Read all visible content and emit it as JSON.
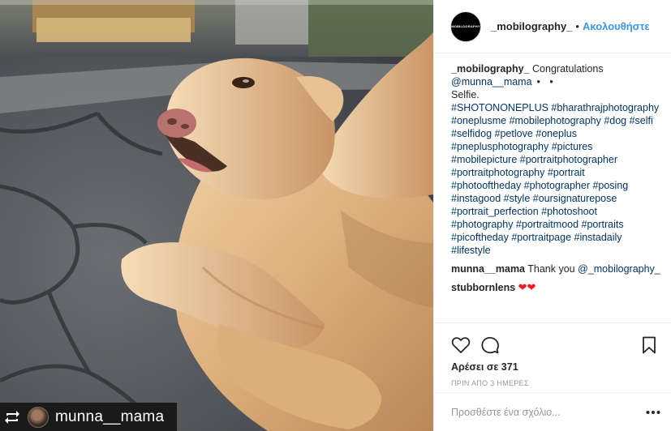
{
  "post": {
    "repost_username": "munna__mama"
  },
  "header": {
    "avatar_text": "MOBILOGRAPHY",
    "username": "_mobilography_",
    "separator": "•",
    "follow_label": "Ακολουθήστε"
  },
  "caption": {
    "username": "_mobilography_",
    "text": "Congratulations",
    "mention": "@munna__mama",
    "dots": "• •",
    "line_selfie": "Selfie.",
    "hashtag_lines": [
      "#SHOTONONEPLUS #bharathrajphotography",
      "#oneplusme #mobilephotography #dog #selfi",
      "#selfidog #petlove #oneplus",
      "#pneplusphotography #pictures",
      "#mobilepicture #portraitphotographer",
      "#portraitphotography #portrait",
      "#photooftheday #photographer #posing",
      "#instagood #style #oursignaturepose",
      "#portrait_perfection #photoshoot",
      "#photography #portraitmood #portraits",
      "#picoftheday #portraitpage #instadaily",
      "#lifestyle"
    ]
  },
  "comments": [
    {
      "username": "munna__mama",
      "text": "Thank you",
      "mention": "@_mobilography_",
      "hearts": ""
    },
    {
      "username": "stubbornlens",
      "text": "",
      "mention": "",
      "hearts": "❤❤"
    }
  ],
  "actions": {
    "likes_text": "Αρέσει σε 371",
    "timestamp": "ΠΡΙΝ ΑΠΟ 3 ΗΜΕΡΕΣ"
  },
  "comment_input": {
    "placeholder": "Προσθέστε ένα σχόλιο..."
  },
  "icons": {
    "like": "heart-outline-icon",
    "comment": "speech-bubble-icon",
    "save": "bookmark-icon",
    "more": "ellipsis-icon",
    "repost": "repost-icon"
  },
  "colors": {
    "link": "#003569",
    "follow": "#3897f0",
    "heart": "#ed1c24",
    "muted": "#999999"
  }
}
